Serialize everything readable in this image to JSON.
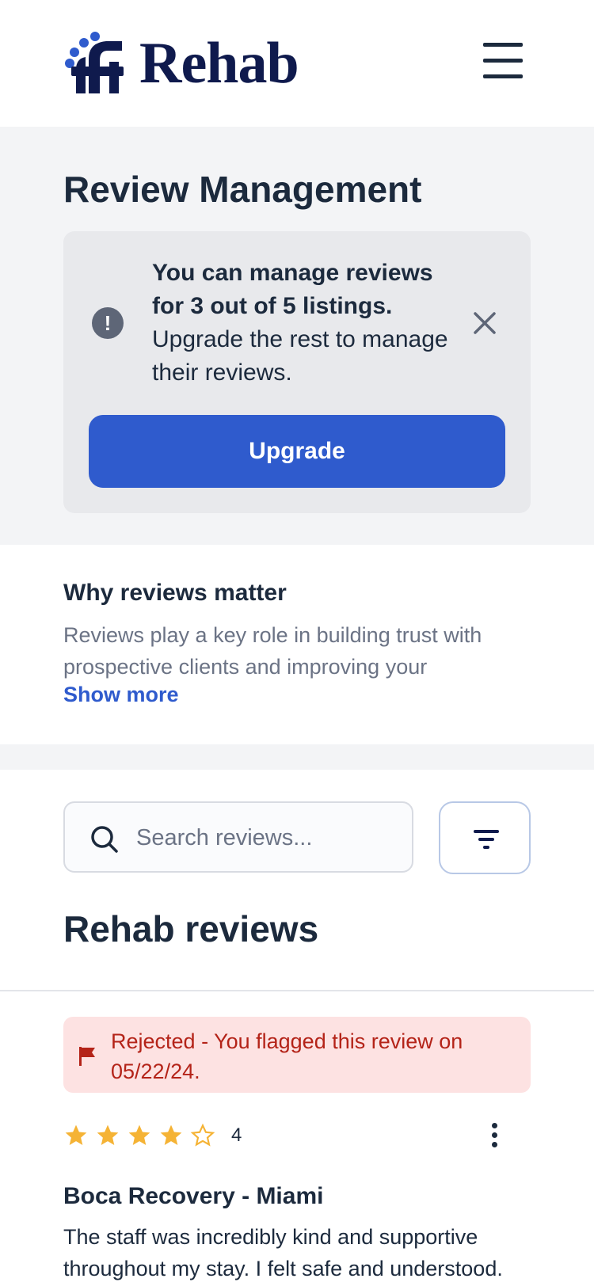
{
  "brand": {
    "name": "Rehab",
    "primary_color": "#2f5bcd",
    "logo_color": "#0f1a4d"
  },
  "header": {
    "menu_icon": "hamburger-icon"
  },
  "review_management": {
    "title": "Review Management",
    "notice": {
      "bold_text": "You can manage reviews for 3 out of 5 listings.",
      "text": " Upgrade the rest to manage their reviews.",
      "upgrade_label": "Upgrade"
    }
  },
  "why": {
    "title": "Why reviews matter",
    "body": "Reviews play a key role in building trust with prospective clients and improving your",
    "show_more": "Show more"
  },
  "search": {
    "placeholder": "Search reviews..."
  },
  "reviews": {
    "title": "Rehab reviews",
    "items": [
      {
        "status_text": "Rejected - You flagged this review on 05/22/24.",
        "rating": 4,
        "rating_label": "4",
        "facility": "Boca Recovery - Miami",
        "body": "The staff was incredibly kind and supportive throughout my stay. I felt safe and understood."
      }
    ]
  }
}
